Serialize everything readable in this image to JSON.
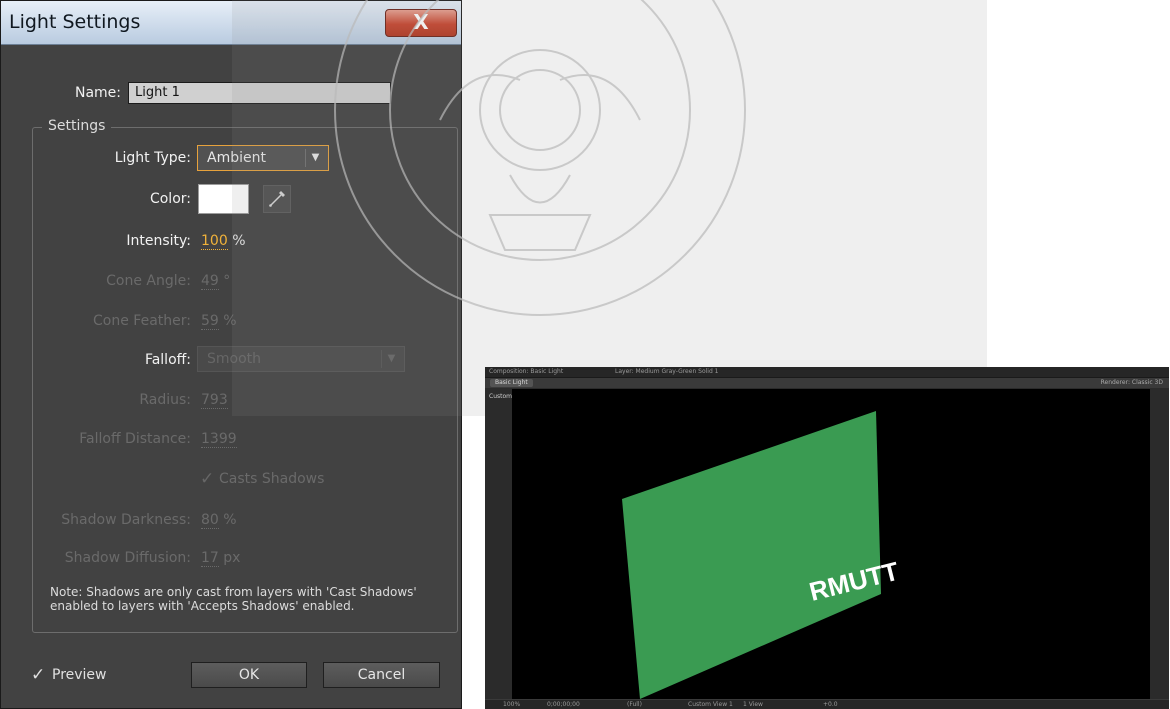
{
  "dialog": {
    "title": "Light Settings",
    "close_label": "X",
    "name_label": "Name:",
    "name_value": "Light 1",
    "settings_group_label": "Settings",
    "light_type": {
      "label": "Light Type:",
      "value": "Ambient"
    },
    "color": {
      "label": "Color:",
      "value": "#ffffff"
    },
    "intensity": {
      "label": "Intensity:",
      "value": "100",
      "unit": "%"
    },
    "cone_angle": {
      "label": "Cone Angle:",
      "value": "49",
      "unit": "°"
    },
    "cone_feather": {
      "label": "Cone Feather:",
      "value": "59",
      "unit": "%"
    },
    "falloff": {
      "label": "Falloff:",
      "value": "Smooth"
    },
    "radius": {
      "label": "Radius:",
      "value": "793"
    },
    "falloff_distance": {
      "label": "Falloff Distance:",
      "value": "1399"
    },
    "casts_shadows": {
      "label": "Casts Shadows",
      "checked": true
    },
    "shadow_darkness": {
      "label": "Shadow Darkness:",
      "value": "80",
      "unit": "%"
    },
    "shadow_diffusion": {
      "label": "Shadow Diffusion:",
      "value": "17",
      "unit": "px"
    },
    "note_line1": "Note: Shadows are only cast from layers with 'Cast Shadows'",
    "note_line2": "enabled to layers with 'Accepts Shadows' enabled.",
    "preview": {
      "label": "Preview",
      "checked": true
    },
    "ok_label": "OK",
    "cancel_label": "Cancel"
  },
  "composition": {
    "header_title": "Composition: Basic Light",
    "header_layer": "Layer: Medium Gray-Green Solid 1",
    "tab_label": "Basic Light",
    "renderer_label": "Renderer:",
    "renderer_value": "Classic 3D",
    "view_label": "Custom View 1",
    "layer_text": "RMUTT",
    "layer_color": "#3a9b52",
    "footer": {
      "zoom": "100%",
      "timecode": "0;00;00;00",
      "resolution": "(Full)",
      "view": "Custom View 1",
      "layout": "1 View",
      "exposure": "+0.0"
    }
  },
  "colors": {
    "dialog_bg": "#424242",
    "accent_orange": "#f0b23a",
    "titlebar": "#c9d9ec",
    "close_button": "#c8432c"
  }
}
